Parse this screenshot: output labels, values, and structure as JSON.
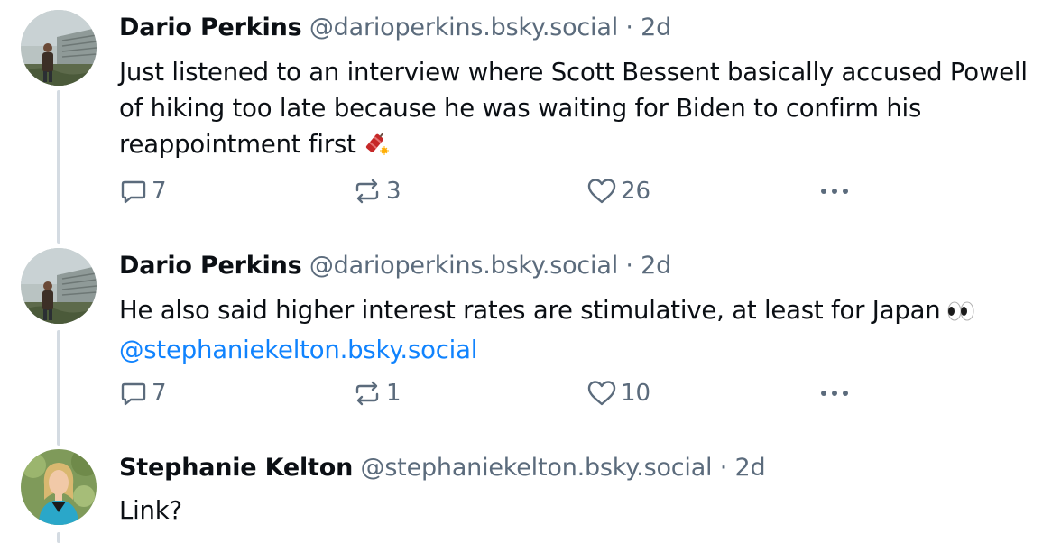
{
  "posts": [
    {
      "author_name": "Dario Perkins",
      "handle": "@darioperkins.bsky.social",
      "separator": "·",
      "time": "2d",
      "text": "Just listened to an interview where Scott Bessent basically accused Powell of hiking too late because he was waiting for Biden to confirm his reappointment first",
      "emoji": "firecracker-icon",
      "replies": "7",
      "reposts": "3",
      "likes": "26"
    },
    {
      "author_name": "Dario Perkins",
      "handle": "@darioperkins.bsky.social",
      "separator": "·",
      "time": "2d",
      "text": "He also said higher interest rates are stimulative, at least for Japan",
      "emoji": "eyes-icon",
      "mention": "@stephaniekelton.bsky.social",
      "replies": "7",
      "reposts": "1",
      "likes": "10"
    },
    {
      "author_name": "Stephanie Kelton",
      "handle": "@stephaniekelton.bsky.social",
      "separator": "·",
      "time": "2d",
      "text": "Link?"
    }
  ],
  "colors": {
    "text": "#0b0f14",
    "muted": "#5b6b7c",
    "link": "#1083fe",
    "thread_line": "#d4dbe2"
  },
  "icons": {
    "reply": "speech-bubble-icon",
    "repost": "repost-arrows-icon",
    "like": "heart-outline-icon",
    "more": "ellipsis-icon"
  }
}
